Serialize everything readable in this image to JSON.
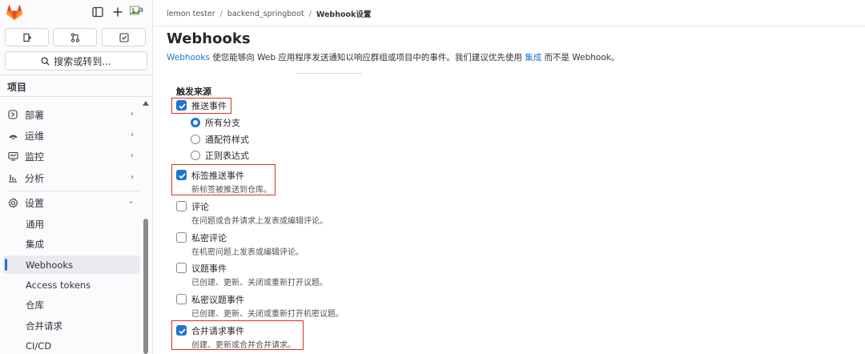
{
  "sidebar": {
    "avatar_alt_text": "a",
    "search_label": "搜索或转到...",
    "project_header": "项目",
    "nav_items": [
      {
        "label": "部署",
        "icon": "deploy-icon"
      },
      {
        "label": "运维",
        "icon": "operate-icon"
      },
      {
        "label": "监控",
        "icon": "monitor-icon"
      },
      {
        "label": "分析",
        "icon": "analytics-icon"
      },
      {
        "label": "设置",
        "icon": "settings-icon"
      }
    ],
    "settings_sub_items": [
      "通用",
      "集成",
      "Webhooks",
      "Access tokens",
      "仓库",
      "合并请求",
      "CI/CD"
    ],
    "active_sub_item": "Webhooks"
  },
  "breadcrumb": {
    "items": [
      "lemon tester",
      "backend_springboot",
      "Webhook设置"
    ],
    "separator": "/"
  },
  "page": {
    "title": "Webhooks",
    "desc_link1": "Webhooks",
    "desc_text1": " 使您能够向 Web 应用程序发送通知以响应群组或项目中的事件。我们建议优先使用 ",
    "desc_link2": "集成",
    "desc_text2": " 而不是 Webhook。"
  },
  "trigger": {
    "section_label": "触发来源",
    "push_events": {
      "label": "推送事件",
      "checked": true
    },
    "branch_options": [
      {
        "label": "所有分支",
        "selected": true
      },
      {
        "label": "通配符样式",
        "selected": false
      },
      {
        "label": "正则表达式",
        "selected": false
      }
    ],
    "events": [
      {
        "label": "标签推送事件",
        "help": "新标签被推送到仓库。",
        "checked": true
      },
      {
        "label": "评论",
        "help": "在问题或合并请求上发表或编辑评论。",
        "checked": false
      },
      {
        "label": "私密评论",
        "help": "在机密问题上发表或编辑评论。",
        "checked": false
      },
      {
        "label": "议题事件",
        "help": "已创建、更新、关闭或重新打开议题。",
        "checked": false
      },
      {
        "label": "私密议题事件",
        "help": "已创建、更新、关闭或重新打开机密议题。",
        "checked": false
      },
      {
        "label": "合并请求事件",
        "help": "创建、更新或合并合并请求。",
        "checked": true
      }
    ]
  },
  "colors": {
    "accent": "#1f75cb",
    "highlight": "#d93025",
    "logo_orange": "#e24329"
  }
}
